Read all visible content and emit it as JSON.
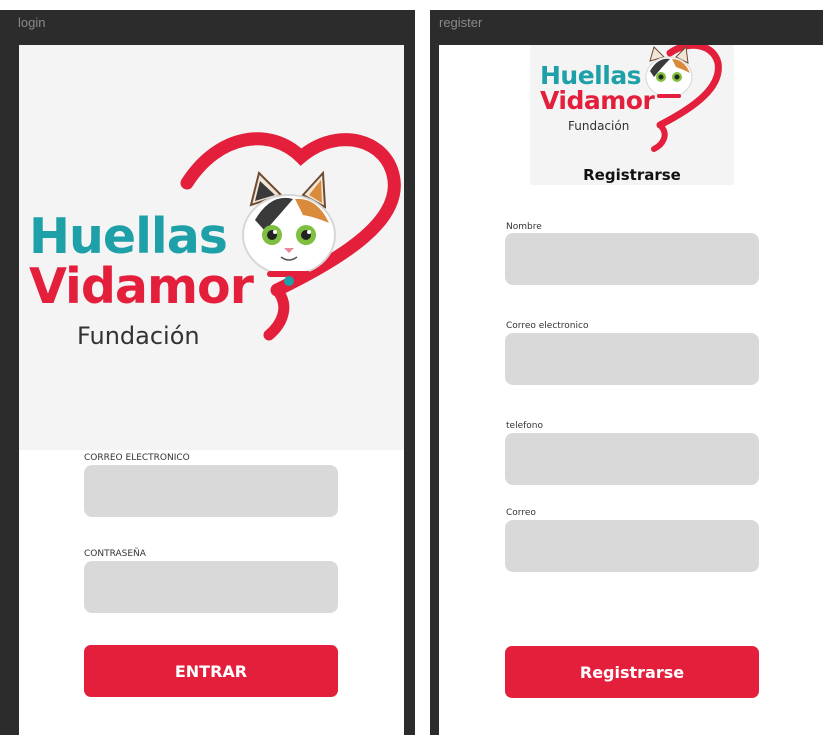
{
  "colors": {
    "brand_teal": "#1ea0a8",
    "brand_red": "#e31f3c",
    "input_fill": "#d9d9d9",
    "frame_dark": "#2c2c2c"
  },
  "logo": {
    "line1": "Huellas",
    "line2": "Vidamor",
    "line3": "Fundación"
  },
  "login": {
    "frame_label": "login",
    "email_label": "CORREO ELECTRONICO",
    "email_value": "",
    "password_label": "CONTRASEÑA",
    "password_value": "",
    "submit_label": "ENTRAR"
  },
  "register": {
    "frame_label": "register",
    "title": "Registrarse",
    "fields": [
      {
        "label": "Nombre",
        "value": ""
      },
      {
        "label": "Correo electronico",
        "value": ""
      },
      {
        "label": "telefono",
        "value": ""
      },
      {
        "label": "Correo",
        "value": ""
      }
    ],
    "submit_label": "Registrarse"
  }
}
